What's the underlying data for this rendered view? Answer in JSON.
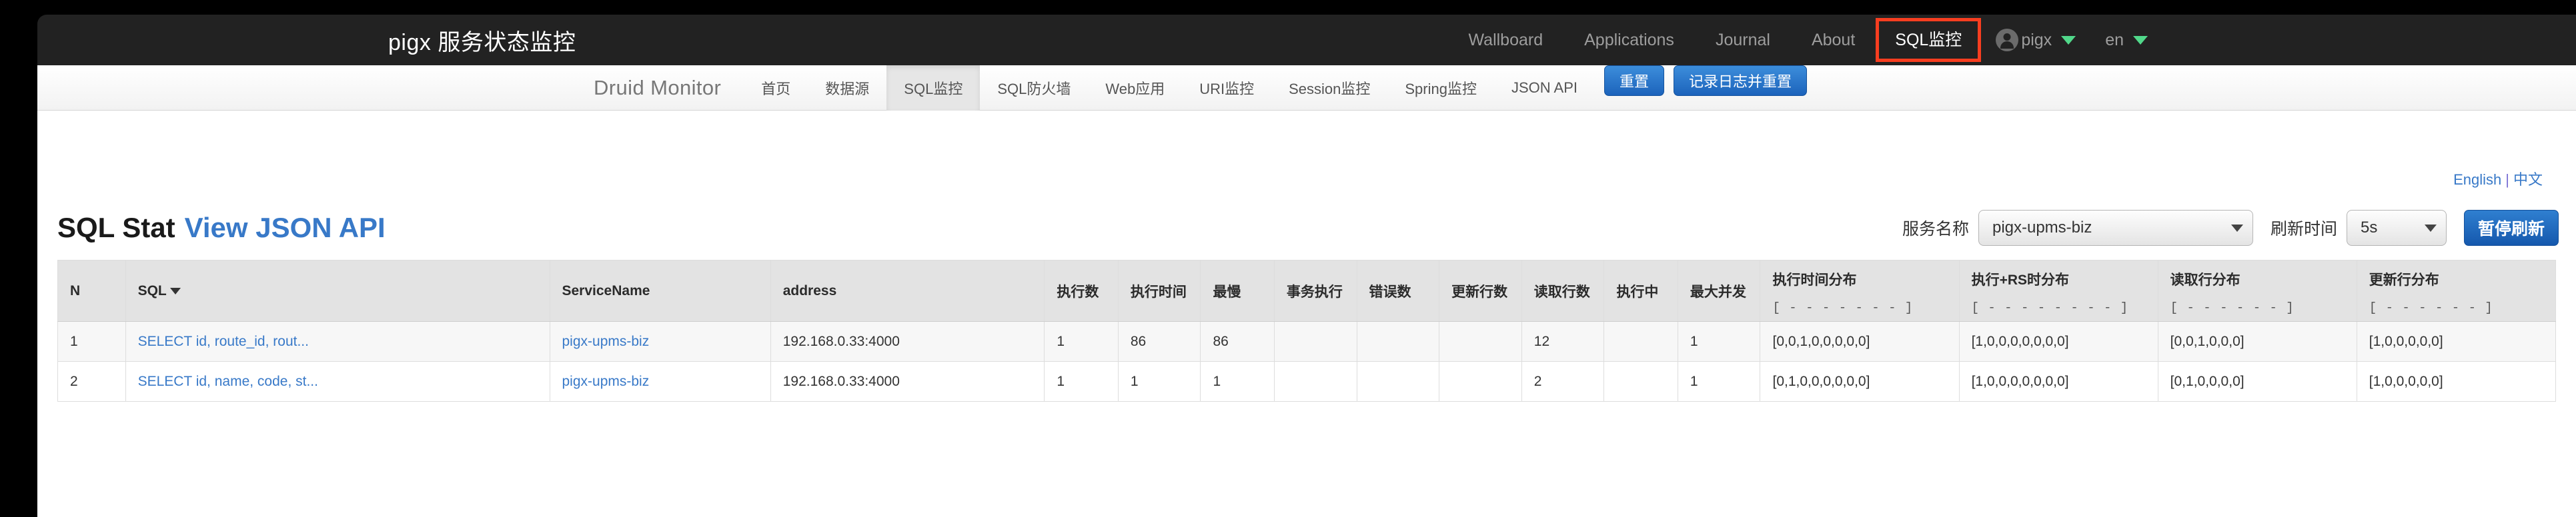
{
  "topbar": {
    "brand": "pigx 服务状态监控",
    "nav": [
      {
        "label": "Wallboard",
        "active": false
      },
      {
        "label": "Applications",
        "active": false
      },
      {
        "label": "Journal",
        "active": false
      },
      {
        "label": "About",
        "active": false
      },
      {
        "label": "SQL监控",
        "active": true
      }
    ],
    "user": "pigx",
    "language": "en",
    "highlight_color": "#f93e20",
    "caret_color": "#51d88a"
  },
  "druidbar": {
    "brand": "Druid Monitor",
    "nav": [
      {
        "label": "首页",
        "active": false
      },
      {
        "label": "数据源",
        "active": false
      },
      {
        "label": "SQL监控",
        "active": true
      },
      {
        "label": "SQL防火墙",
        "active": false
      },
      {
        "label": "Web应用",
        "active": false
      },
      {
        "label": "URI监控",
        "active": false
      },
      {
        "label": "Session监控",
        "active": false
      },
      {
        "label": "Spring监控",
        "active": false
      },
      {
        "label": "JSON API",
        "active": false
      }
    ],
    "buttons": [
      {
        "label": "重置"
      },
      {
        "label": "记录日志并重置"
      }
    ],
    "button_color": "#1c63bb"
  },
  "lang_links": {
    "english": "English",
    "separator": "|",
    "chinese": "中文",
    "link_color": "#3879c8"
  },
  "stat": {
    "title": "SQL Stat",
    "api_link": "View JSON API",
    "service_label": "服务名称",
    "service_value": "pigx-upms-biz",
    "refresh_label": "刷新时间",
    "refresh_value": "5s",
    "pause_label": "暂停刷新"
  },
  "table": {
    "headers": [
      {
        "label": "N",
        "sort": false
      },
      {
        "label": "SQL",
        "sort": true
      },
      {
        "label": "ServiceName",
        "sort": false
      },
      {
        "label": "address",
        "sort": false
      },
      {
        "label": "执行数",
        "sort": false
      },
      {
        "label": "执行时间",
        "sort": false
      },
      {
        "label": "最慢",
        "sort": false
      },
      {
        "label": "事务执行",
        "sort": false
      },
      {
        "label": "错误数",
        "sort": false
      },
      {
        "label": "更新行数",
        "sort": false
      },
      {
        "label": "读取行数",
        "sort": false
      },
      {
        "label": "执行中",
        "sort": false
      },
      {
        "label": "最大并发",
        "sort": false
      }
    ],
    "dist_headers": [
      {
        "label": "执行时间分布",
        "pattern": "[ - - - - - - - ]"
      },
      {
        "label": "执行+RS时分布",
        "pattern": "[ - - - - - - - - ]"
      },
      {
        "label": "读取行分布",
        "pattern": "[ - - - - - - ]"
      },
      {
        "label": "更新行分布",
        "pattern": "[ - - - - - - ]"
      }
    ],
    "rows": [
      {
        "n": "1",
        "sql": "SELECT id, route_id, rout...",
        "service": "pigx-upms-biz",
        "address": "192.168.0.33:4000",
        "exec_count": "1",
        "exec_time": "86",
        "slowest": "86",
        "tx_exec": "",
        "error_count": "",
        "update_rows": "",
        "read_rows": "12",
        "running": "",
        "max_concurrent": "1",
        "exec_time_dist": "[0,0,1,0,0,0,0,0]",
        "exec_rs_dist": "[1,0,0,0,0,0,0,0]",
        "read_row_dist": "[0,0,1,0,0,0]",
        "update_row_dist": "[1,0,0,0,0,0]"
      },
      {
        "n": "2",
        "sql": "SELECT id, name, code, st...",
        "service": "pigx-upms-biz",
        "address": "192.168.0.33:4000",
        "exec_count": "1",
        "exec_time": "1",
        "slowest": "1",
        "tx_exec": "",
        "error_count": "",
        "update_rows": "",
        "read_rows": "2",
        "running": "",
        "max_concurrent": "1",
        "exec_time_dist": "[0,1,0,0,0,0,0,0]",
        "exec_rs_dist": "[1,0,0,0,0,0,0,0]",
        "read_row_dist": "[0,1,0,0,0,0]",
        "update_row_dist": "[1,0,0,0,0,0]"
      }
    ]
  }
}
